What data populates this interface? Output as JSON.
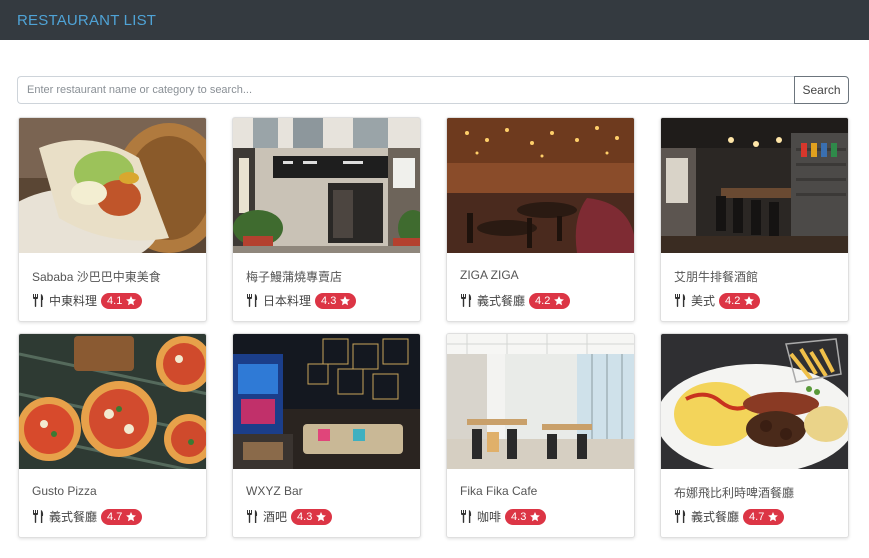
{
  "navbar": {
    "brand": "RESTAURANT LIST"
  },
  "search": {
    "placeholder": "Enter restaurant name or category to search...",
    "button_label": "Search"
  },
  "icons": {
    "category": "utensils-icon",
    "rating": "star-icon"
  },
  "colors": {
    "navbar": "#343a40",
    "brand": "#4fa3d6",
    "badge": "#dc3545"
  },
  "restaurants": [
    {
      "name": "Sababa 沙巴巴中東美食",
      "category": "中東料理",
      "rating": "4.1"
    },
    {
      "name": "梅子鰻蒲燒專賣店",
      "category": "日本料理",
      "rating": "4.3"
    },
    {
      "name": "ZIGA ZIGA",
      "category": "義式餐廳",
      "rating": "4.2"
    },
    {
      "name": "艾朋牛排餐酒館",
      "category": "美式",
      "rating": "4.2"
    },
    {
      "name": "Gusto Pizza",
      "category": "義式餐廳",
      "rating": "4.7"
    },
    {
      "name": "WXYZ Bar",
      "category": "酒吧",
      "rating": "4.3"
    },
    {
      "name": "Fika Fika Cafe",
      "category": "咖啡",
      "rating": "4.3"
    },
    {
      "name": "布娜飛比利時啤酒餐廳",
      "category": "義式餐廳",
      "rating": "4.7"
    }
  ]
}
